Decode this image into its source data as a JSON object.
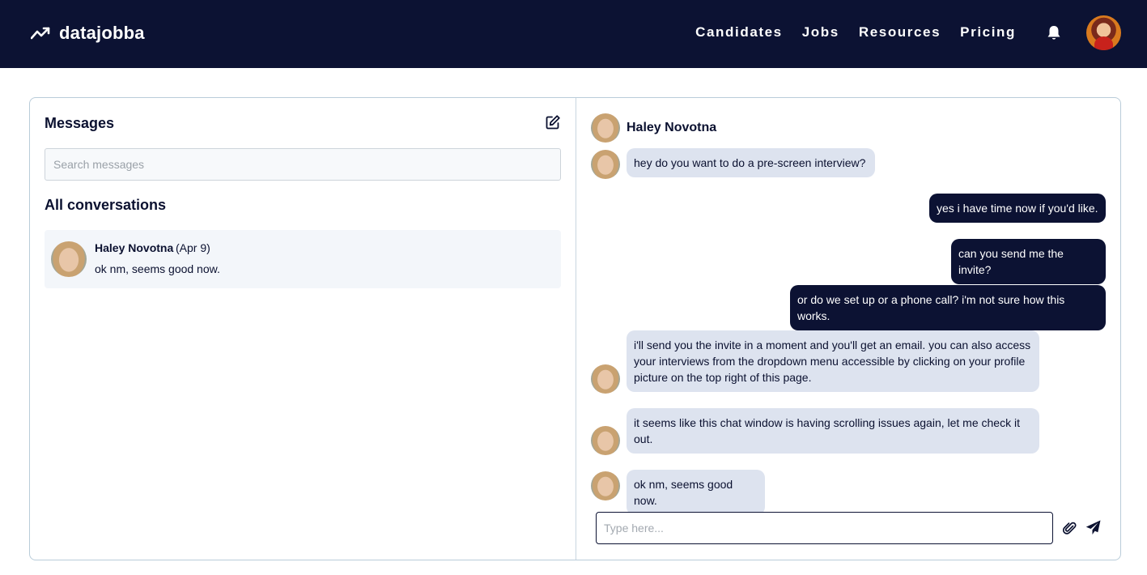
{
  "brand": {
    "name": "datajobba",
    "logo_icon": "trend-line-icon"
  },
  "nav": {
    "links": [
      "Candidates",
      "Jobs",
      "Resources",
      "Pricing"
    ],
    "notification_icon": "bell-icon",
    "profile_icon": "avatar"
  },
  "colors": {
    "nav_bg": "#0c1233",
    "outgoing_bubble": "#0c1233",
    "incoming_bubble": "#dde3ef",
    "conversation_bg": "#f3f6fa"
  },
  "sidebar": {
    "title": "Messages",
    "compose_icon": "edit-icon",
    "search_placeholder": "Search messages",
    "section_title": "All conversations",
    "conversations": [
      {
        "name": "Haley Novotna",
        "date": "(Apr 9)",
        "preview": "ok nm, seems good now."
      }
    ]
  },
  "chat": {
    "contact_name": "Haley Novotna",
    "messages": [
      {
        "from": "them",
        "text": "hey do you want to do a pre-screen interview?"
      },
      {
        "from": "me",
        "text": "yes i have time now if you'd like."
      },
      {
        "from": "me",
        "text": "can you send me the invite?"
      },
      {
        "from": "me",
        "text": "or do we set up or a phone call? i'm not sure how this works."
      },
      {
        "from": "them",
        "text": "i'll send you the invite in a moment and you'll get an email. you can also access your interviews from the dropdown menu accessible by clicking on your profile picture on the top right of this page."
      },
      {
        "from": "them",
        "text": "it seems like this chat window is having scrolling issues again, let me check it out."
      },
      {
        "from": "them",
        "text": "ok nm, seems good now."
      }
    ],
    "input_placeholder": "Type here...",
    "attach_icon": "paperclip-icon",
    "send_icon": "send-icon"
  }
}
